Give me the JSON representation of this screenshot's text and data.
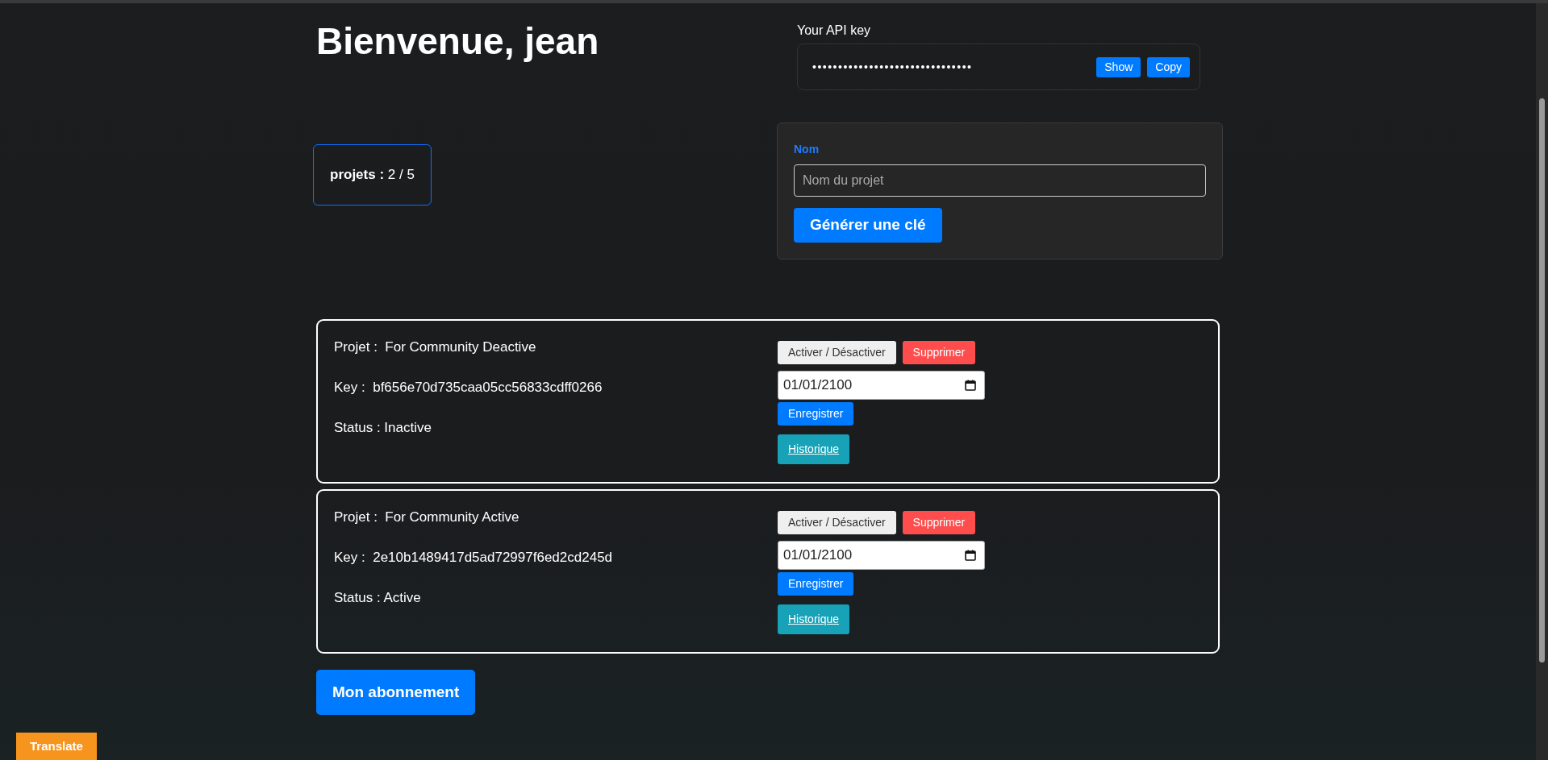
{
  "heading": "Bienvenue, jean",
  "api_key": {
    "label": "Your API key",
    "masked_value": "•••••••••••••••••••••••••••••••",
    "buttons": [
      "Show",
      "Copy"
    ]
  },
  "project_count": "**projets :** 2 / 5",
  "new_project_form": {
    "label": "Nom",
    "placeholder": "Nom du projet",
    "submit": "Générer une clé"
  },
  "projects": [
    {
      "name_line": "Projet :  For Community Deactive",
      "key_line": "Key :  bf656e70d735caa05cc56833cdff0266",
      "status_line": "Status : Inactive",
      "toggle_button": "Activer / Désactiver",
      "delete_button": "Supprimer",
      "expiry_date": "01/01/2100",
      "save_button": "Enregistrer",
      "history_link": "Historique"
    },
    {
      "name_line": "Projet :  For Community Active",
      "key_line": "Key :  2e10b1489417d5ad72997f6ed2cd245d",
      "status_line": "Status : Active",
      "toggle_button": "Activer / Désactiver",
      "delete_button": "Supprimer",
      "expiry_date": "01/01/2100",
      "save_button": "Enregistrer",
      "history_link": "Historique"
    }
  ],
  "subscription_button": "Mon abonnement",
  "translate_button": "Translate"
}
